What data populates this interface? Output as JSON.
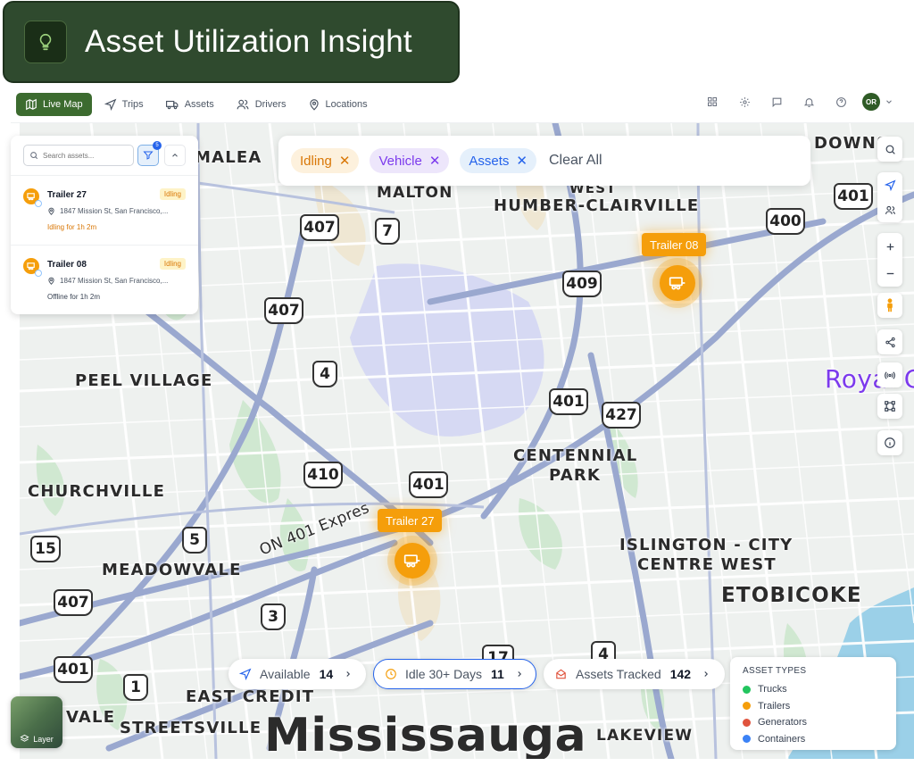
{
  "banner": {
    "title": "Asset Utilization Insight",
    "icon": "lightbulb-icon"
  },
  "nav": {
    "items": [
      {
        "label": "Live Map",
        "icon": "map-icon",
        "active": true
      },
      {
        "label": "Trips",
        "icon": "navigation-icon"
      },
      {
        "label": "Assets",
        "icon": "truck-icon"
      },
      {
        "label": "Drivers",
        "icon": "users-icon"
      },
      {
        "label": "Locations",
        "icon": "map-pin-icon"
      }
    ],
    "right_icons": [
      "grid-icon",
      "gear-icon",
      "chat-icon",
      "bell-icon",
      "help-icon"
    ],
    "avatar_initials": "OR"
  },
  "panel": {
    "search_placeholder": "Search assets...",
    "filter_count": "5",
    "assets": [
      {
        "name": "Trailer 27",
        "status_badge": "Idling",
        "address": "1847 Mission St, San Francisco,...",
        "status_text": "Idling for 1h 2m",
        "status_color": "#d97706"
      },
      {
        "name": "Trailer 08",
        "status_badge": "Idling",
        "address": "1847 Mission St, San Francisco,...",
        "status_text": "Offline for 1h 2m",
        "status_color": "#374151"
      }
    ]
  },
  "filters": {
    "chips": [
      {
        "label": "Idling"
      },
      {
        "label": "Vehicle"
      },
      {
        "label": "Assets"
      }
    ],
    "clear_all": "Clear All"
  },
  "map": {
    "places": [
      {
        "text": "MALEA"
      },
      {
        "text": "MALTON"
      },
      {
        "text": "WEST"
      },
      {
        "text": "HUMBER-CLAIRVILLE"
      },
      {
        "text": "DOWNS"
      },
      {
        "text": "PEEL VILLAGE"
      },
      {
        "text": "CENTENNIAL"
      },
      {
        "text": "PARK"
      },
      {
        "text": "CHURCHVILLE"
      },
      {
        "text": "MEADOWVALE"
      },
      {
        "text": "ISLINGTON - CITY"
      },
      {
        "text": "CENTRE WEST"
      },
      {
        "text": "ETOBICOKE"
      },
      {
        "text": "EAST CREDIT"
      },
      {
        "text": "VALE"
      },
      {
        "text": "STREETSVILLE"
      },
      {
        "text": "LAKEVIEW"
      },
      {
        "text": "Mississauga"
      },
      {
        "text": "Royal C"
      },
      {
        "text": "ON 401 Expres"
      }
    ],
    "shields": [
      "407",
      "7",
      "407",
      "4",
      "410",
      "401",
      "409",
      "401",
      "427",
      "401",
      "400",
      "5",
      "15",
      "407",
      "3",
      "401",
      "1",
      "17",
      "4"
    ],
    "markers": [
      {
        "label": "Trailer 08",
        "icon": "trailer-icon"
      },
      {
        "label": "Trailer 27",
        "icon": "trailer-icon"
      }
    ]
  },
  "stats": [
    {
      "label": "Available",
      "count": "14",
      "icon": "navigation-icon"
    },
    {
      "label": "Idle 30+ Days",
      "count": "11",
      "icon": "clock-icon"
    },
    {
      "label": "Assets Tracked",
      "count": "142",
      "icon": "tracked-icon"
    }
  ],
  "legend": {
    "title": "ASSET TYPES",
    "items": [
      {
        "label": "Trucks",
        "color": "#22c55e"
      },
      {
        "label": "Trailers",
        "color": "#f59e0b"
      },
      {
        "label": "Generators",
        "color": "#e0533d"
      },
      {
        "label": "Containers",
        "color": "#3b82f6"
      }
    ]
  },
  "layer": {
    "label": "Layer",
    "icon": "layers-icon"
  },
  "tools": [
    "search-icon",
    "locate-icon",
    "people-icon",
    "zoom-in-icon",
    "zoom-out-icon",
    "pegman-icon",
    "share-icon",
    "broadcast-icon",
    "route-icon",
    "info-icon"
  ]
}
